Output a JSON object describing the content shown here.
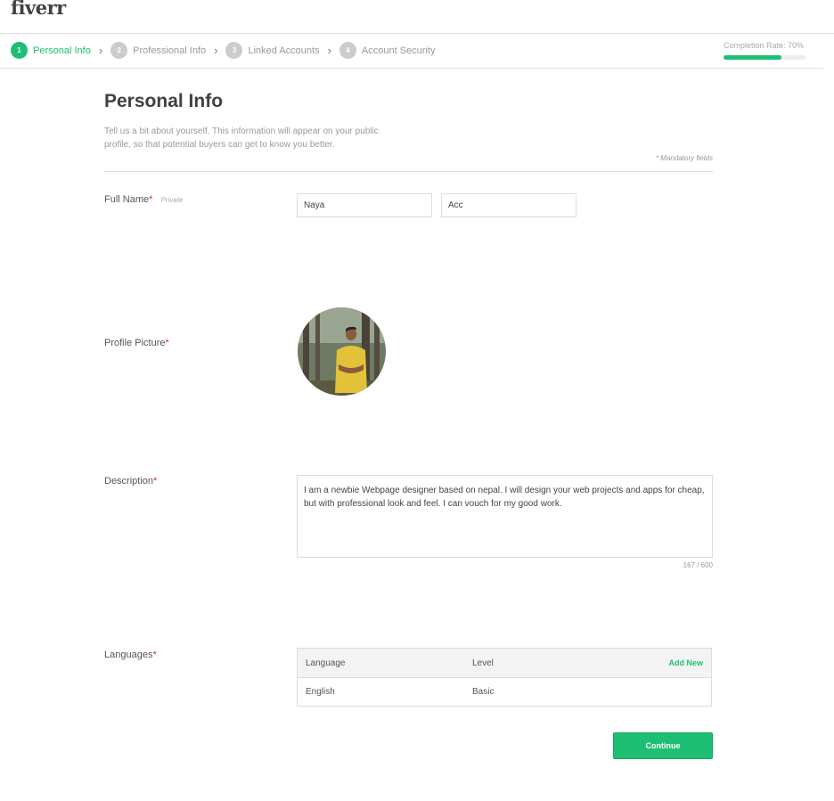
{
  "logo": "fiverr",
  "steps": [
    {
      "num": "1",
      "label": "Personal Info"
    },
    {
      "num": "2",
      "label": "Professional Info"
    },
    {
      "num": "3",
      "label": "Linked Accounts"
    },
    {
      "num": "4",
      "label": "Account Security"
    }
  ],
  "completion": {
    "label": "Completion Rate: 70%",
    "value": 0.7
  },
  "page": {
    "title": "Personal Info",
    "intro": "Tell us a bit about yourself. This information will appear on your public profile, so that potential buyers can get to know you better.",
    "mandatory_note": "* Mandatory fields"
  },
  "full_name": {
    "label": "Full Name",
    "private_tag": "Private",
    "first": "Naya",
    "last": "Acc"
  },
  "profile_picture": {
    "label": "Profile Picture"
  },
  "description": {
    "label": "Description",
    "text": "I am a newbie Webpage designer based on nepal. I will design your web projects and apps for cheap, but with professional look and feel. I can vouch for my good work.",
    "counter": "167 / 600"
  },
  "languages": {
    "label": "Languages",
    "col_language": "Language",
    "col_level": "Level",
    "add_new": "Add New",
    "rows": [
      {
        "language": "English",
        "level": "Basic"
      }
    ]
  },
  "continue_label": "Continue",
  "required_mark": "*",
  "colors": {
    "accent": "#1dbf73",
    "required": "#c0392b"
  }
}
